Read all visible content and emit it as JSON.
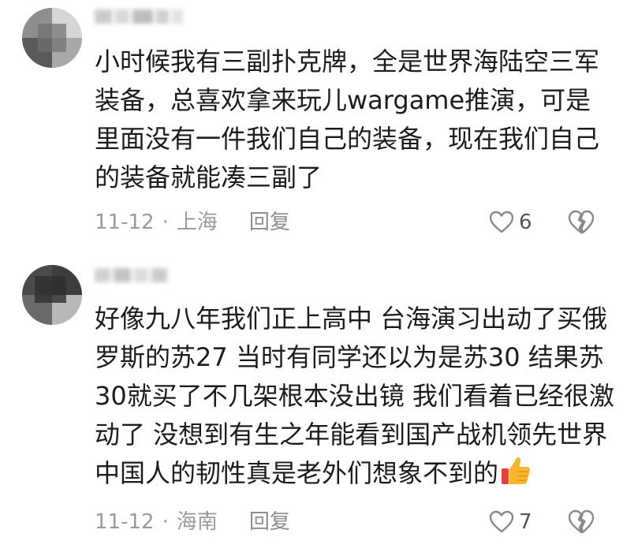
{
  "comments": [
    {
      "username": "xlvgxxx",
      "text": "小时候我有三副扑克牌，全是世界海陆空三军装备，总喜欢拿来玩儿wargame推演，可是里面没有一件我们自己的装备，现在我们自己的装备就能凑三副了",
      "date": "11-12",
      "separator": "·",
      "location": "上海",
      "reply_label": "回复",
      "likes": "6"
    },
    {
      "username": "xxxxxx",
      "text": "好像九八年我们正上高中 台海演习出动了买俄罗斯的苏27 当时有同学还以为是苏30 结果苏30就买了不几架根本没出镜 我们看着已经很激动了 没想到有生之年能看到国产战机领先世界 中国人的韧性真是老外们想象不到的",
      "emoji": "thumbs-up",
      "date": "11-12",
      "separator": "·",
      "location": "海南",
      "reply_label": "回复",
      "likes": "7"
    }
  ],
  "colors": {
    "text": "#1c1c1c",
    "meta": "#9a9a9a",
    "icon": "#8a8a8a",
    "emoji_yellow": "#f7b52c",
    "emoji_red": "#e8413b"
  }
}
